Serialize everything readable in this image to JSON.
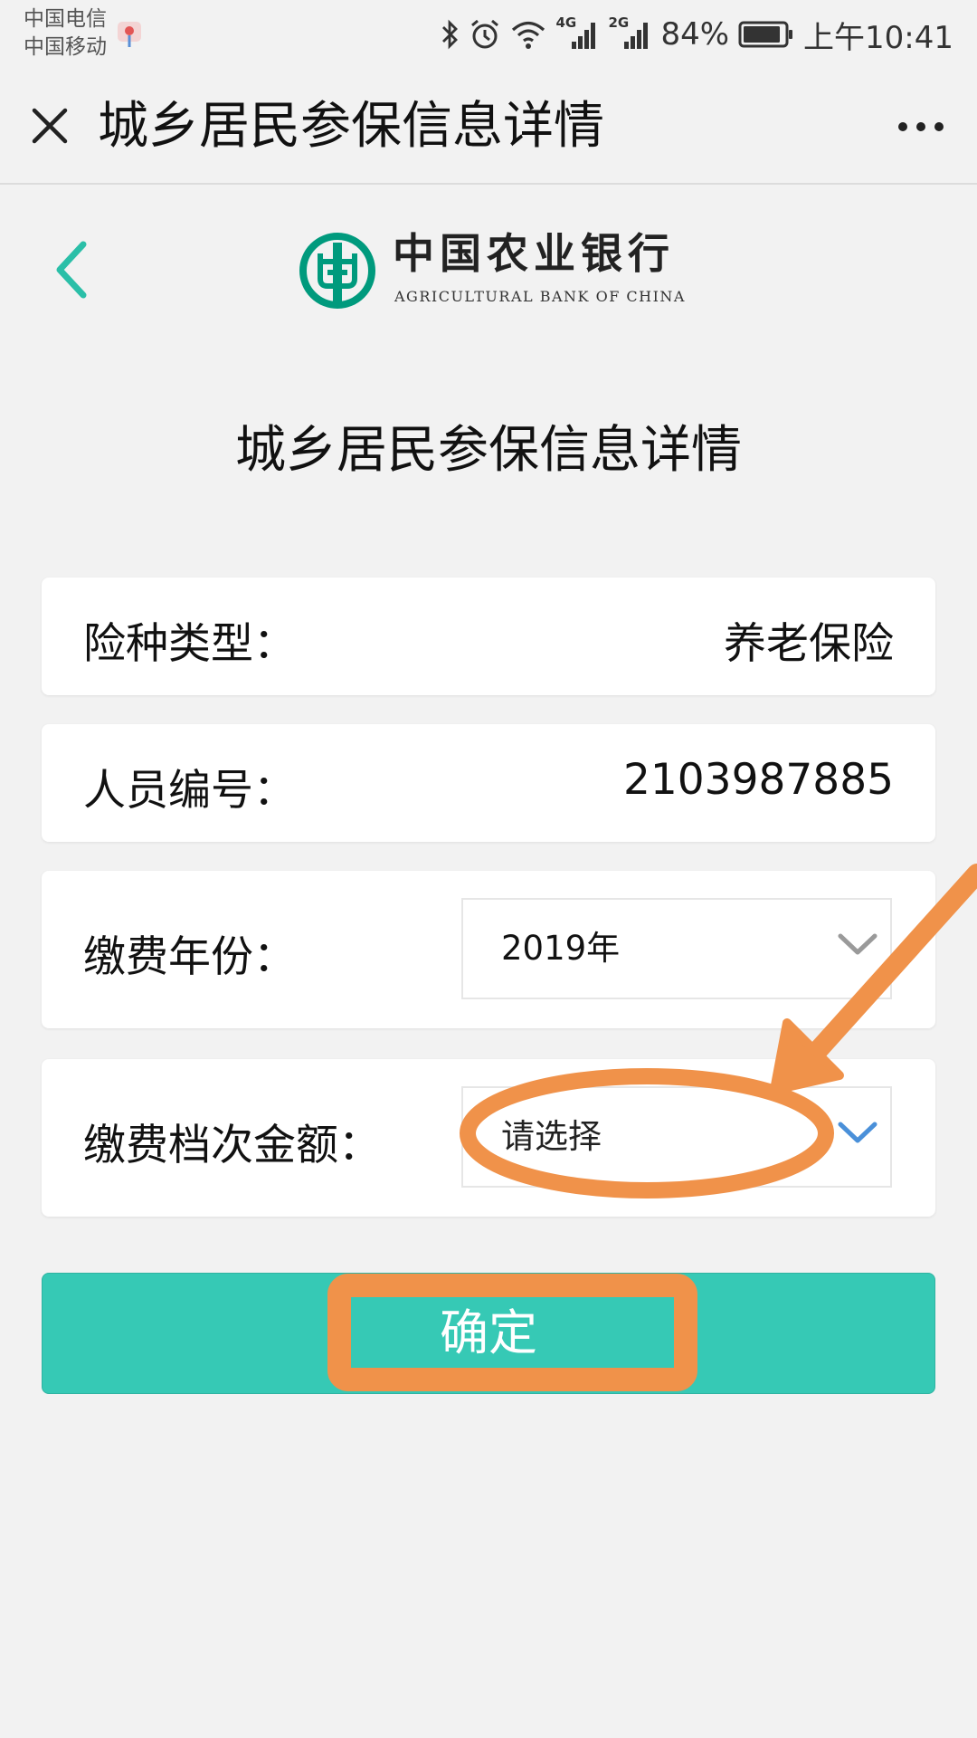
{
  "status_bar": {
    "carriers": [
      "中国电信",
      "中国移动"
    ],
    "network_4g": "4G",
    "network_2g": "2G",
    "battery": "84%",
    "time": "上午10:41"
  },
  "title_bar": {
    "title": "城乡居民参保信息详情",
    "more_label": "···"
  },
  "bank": {
    "name_cn": "中国农业银行",
    "name_en": "AGRICULTURAL BANK OF CHINA"
  },
  "page": {
    "heading": "城乡居民参保信息详情"
  },
  "form": {
    "insurance_type": {
      "label": "险种类型：",
      "value": "养老保险"
    },
    "person_id": {
      "label": "人员编号：",
      "value": "2103987885"
    },
    "pay_year": {
      "label": "缴费年份：",
      "selected": "2019年"
    },
    "pay_level": {
      "label": "缴费档次金额：",
      "placeholder": "请选择"
    }
  },
  "confirm": {
    "label": "确定"
  },
  "colors": {
    "accent": "#36c9b5",
    "back_arrow": "#2bbfa8",
    "bank_green": "#009a7d",
    "chevron_active": "#4a90d9",
    "chevron_muted": "#9a9a9a",
    "annotation": "#f0924a"
  }
}
